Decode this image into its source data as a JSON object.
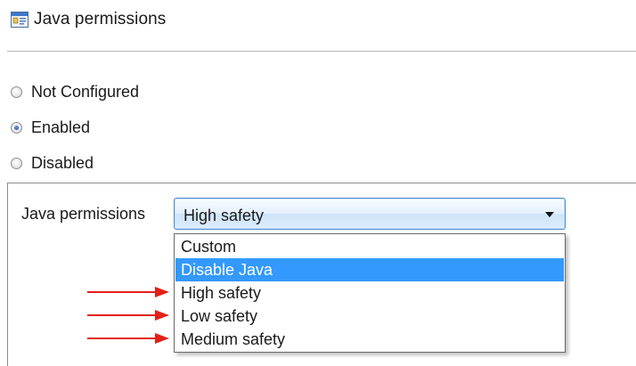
{
  "header": {
    "title": "Java permissions",
    "icon": "policy-setting-icon"
  },
  "radios": {
    "not_configured": {
      "label": "Not Configured",
      "checked": false
    },
    "enabled": {
      "label": "Enabled",
      "checked": true
    },
    "disabled": {
      "label": "Disabled",
      "checked": false
    }
  },
  "options": {
    "field_label": "Java permissions",
    "selected_value": "High safety",
    "dropdown_items": [
      {
        "label": "Custom",
        "highlighted": false
      },
      {
        "label": "Disable Java",
        "highlighted": true
      },
      {
        "label": "High safety",
        "highlighted": false
      },
      {
        "label": "Low safety",
        "highlighted": false
      },
      {
        "label": "Medium safety",
        "highlighted": false
      }
    ]
  },
  "annotations": {
    "arrow_color": "#e32018",
    "arrow_targets": [
      "High safety",
      "Low safety",
      "Medium safety"
    ]
  },
  "colors": {
    "highlight": "#3399ff",
    "combo_border": "#4f8bd0"
  }
}
